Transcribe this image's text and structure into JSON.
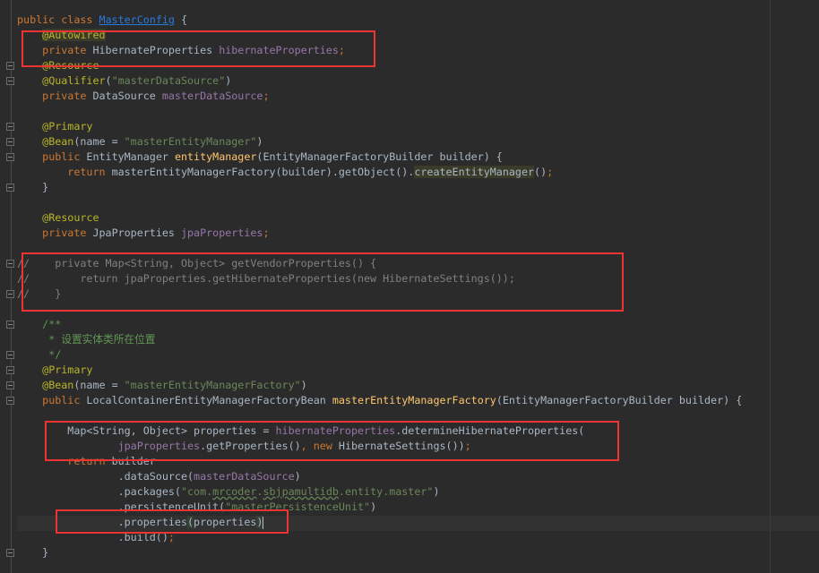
{
  "editor": {
    "lines": [
      [
        [
          "k",
          "public class "
        ],
        [
          "u",
          "MasterConfig"
        ],
        [
          "t",
          " {"
        ]
      ],
      [
        [
          "t",
          "    "
        ],
        [
          "a hl",
          "@Autowired"
        ]
      ],
      [
        [
          "t",
          "    "
        ],
        [
          "k",
          "private "
        ],
        [
          "t",
          "HibernateProperties "
        ],
        [
          "f",
          "hibernateProperties"
        ],
        [
          "p",
          ";"
        ]
      ],
      [
        [
          "t",
          "    "
        ],
        [
          "a",
          "@Resource"
        ]
      ],
      [
        [
          "t",
          "    "
        ],
        [
          "a",
          "@Qualifier"
        ],
        [
          "t",
          "("
        ],
        [
          "s",
          "\"masterDataSource\""
        ],
        [
          "t",
          ")"
        ]
      ],
      [
        [
          "t",
          "    "
        ],
        [
          "k",
          "private "
        ],
        [
          "t",
          "DataSource "
        ],
        [
          "f",
          "masterDataSource"
        ],
        [
          "p",
          ";"
        ]
      ],
      [],
      [
        [
          "t",
          "    "
        ],
        [
          "a",
          "@Primary"
        ]
      ],
      [
        [
          "t",
          "    "
        ],
        [
          "a",
          "@Bean"
        ],
        [
          "t",
          "(name = "
        ],
        [
          "s",
          "\"masterEntityManager\""
        ],
        [
          "t",
          ")"
        ]
      ],
      [
        [
          "t",
          "    "
        ],
        [
          "k",
          "public "
        ],
        [
          "t",
          "EntityManager "
        ],
        [
          "m",
          "entityManager"
        ],
        [
          "t",
          "(EntityManagerFactoryBuilder builder) {"
        ]
      ],
      [
        [
          "t",
          "        "
        ],
        [
          "k",
          "return "
        ],
        [
          "t",
          "masterEntityManagerFactory(builder).getObject()."
        ],
        [
          "t hl",
          "createEntityManager"
        ],
        [
          "t",
          "()"
        ],
        [
          "p",
          ";"
        ]
      ],
      [
        [
          "t",
          "    }"
        ]
      ],
      [],
      [
        [
          "t",
          "    "
        ],
        [
          "a",
          "@Resource"
        ]
      ],
      [
        [
          "t",
          "    "
        ],
        [
          "k",
          "private "
        ],
        [
          "t",
          "JpaProperties "
        ],
        [
          "f",
          "jpaProperties"
        ],
        [
          "p",
          ";"
        ]
      ],
      [],
      [
        [
          "c",
          "//    private Map<String, Object> getVendorProperties() {"
        ]
      ],
      [
        [
          "c",
          "//        return jpaProperties.getHibernateProperties(new HibernateSettings());"
        ]
      ],
      [
        [
          "c",
          "//    }"
        ]
      ],
      [],
      [
        [
          "t",
          "    "
        ],
        [
          "d",
          "/**"
        ]
      ],
      [
        [
          "t",
          "     "
        ],
        [
          "d",
          "* 设置实体类所在位置"
        ]
      ],
      [
        [
          "t",
          "     "
        ],
        [
          "d",
          "*/"
        ]
      ],
      [
        [
          "t",
          "    "
        ],
        [
          "a",
          "@Primary"
        ]
      ],
      [
        [
          "t",
          "    "
        ],
        [
          "a",
          "@Bean"
        ],
        [
          "t",
          "(name = "
        ],
        [
          "s",
          "\"masterEntityManagerFactory\""
        ],
        [
          "t",
          ")"
        ]
      ],
      [
        [
          "t",
          "    "
        ],
        [
          "k",
          "public "
        ],
        [
          "t",
          "LocalContainerEntityManagerFactoryBean "
        ],
        [
          "m",
          "masterEntityManagerFactory"
        ],
        [
          "t",
          "(EntityManagerFactoryBuilder builder) {"
        ]
      ],
      [],
      [
        [
          "t",
          "        Map<String, Object> properties = "
        ],
        [
          "f",
          "hibernateProperties"
        ],
        [
          "t",
          ".determineHibernateProperties("
        ]
      ],
      [
        [
          "t",
          "                "
        ],
        [
          "f",
          "jpaProperties"
        ],
        [
          "t",
          ".getProperties()"
        ],
        [
          "p",
          ", "
        ],
        [
          "k",
          "new "
        ],
        [
          "t",
          "HibernateSettings())"
        ],
        [
          "p",
          ";"
        ]
      ],
      [
        [
          "t",
          "        "
        ],
        [
          "k",
          "return "
        ],
        [
          "t",
          "builder"
        ]
      ],
      [
        [
          "t",
          "                .dataSource("
        ],
        [
          "f",
          "masterDataSource"
        ],
        [
          "t",
          ")"
        ]
      ],
      [
        [
          "t",
          "                .packages("
        ],
        [
          "s",
          "\"com."
        ],
        [
          "s w",
          "mrcoder"
        ],
        [
          "s",
          "."
        ],
        [
          "s w",
          "sbjpamultidb"
        ],
        [
          "s",
          ".entity.master\""
        ],
        [
          "t",
          ")"
        ]
      ],
      [
        [
          "t",
          "                .persistenceUnit("
        ],
        [
          "s",
          "\"masterPersistenceUnit\""
        ],
        [
          "t",
          ")"
        ]
      ],
      [
        [
          "t",
          "                .properties"
        ],
        [
          "t hm",
          "("
        ],
        [
          "t",
          "properties"
        ],
        [
          "t hm",
          ")"
        ],
        [
          "caret",
          ""
        ]
      ],
      [
        [
          "t",
          "                .build()"
        ],
        [
          "p",
          ";"
        ]
      ],
      [
        [
          "t",
          "    }"
        ]
      ]
    ]
  }
}
